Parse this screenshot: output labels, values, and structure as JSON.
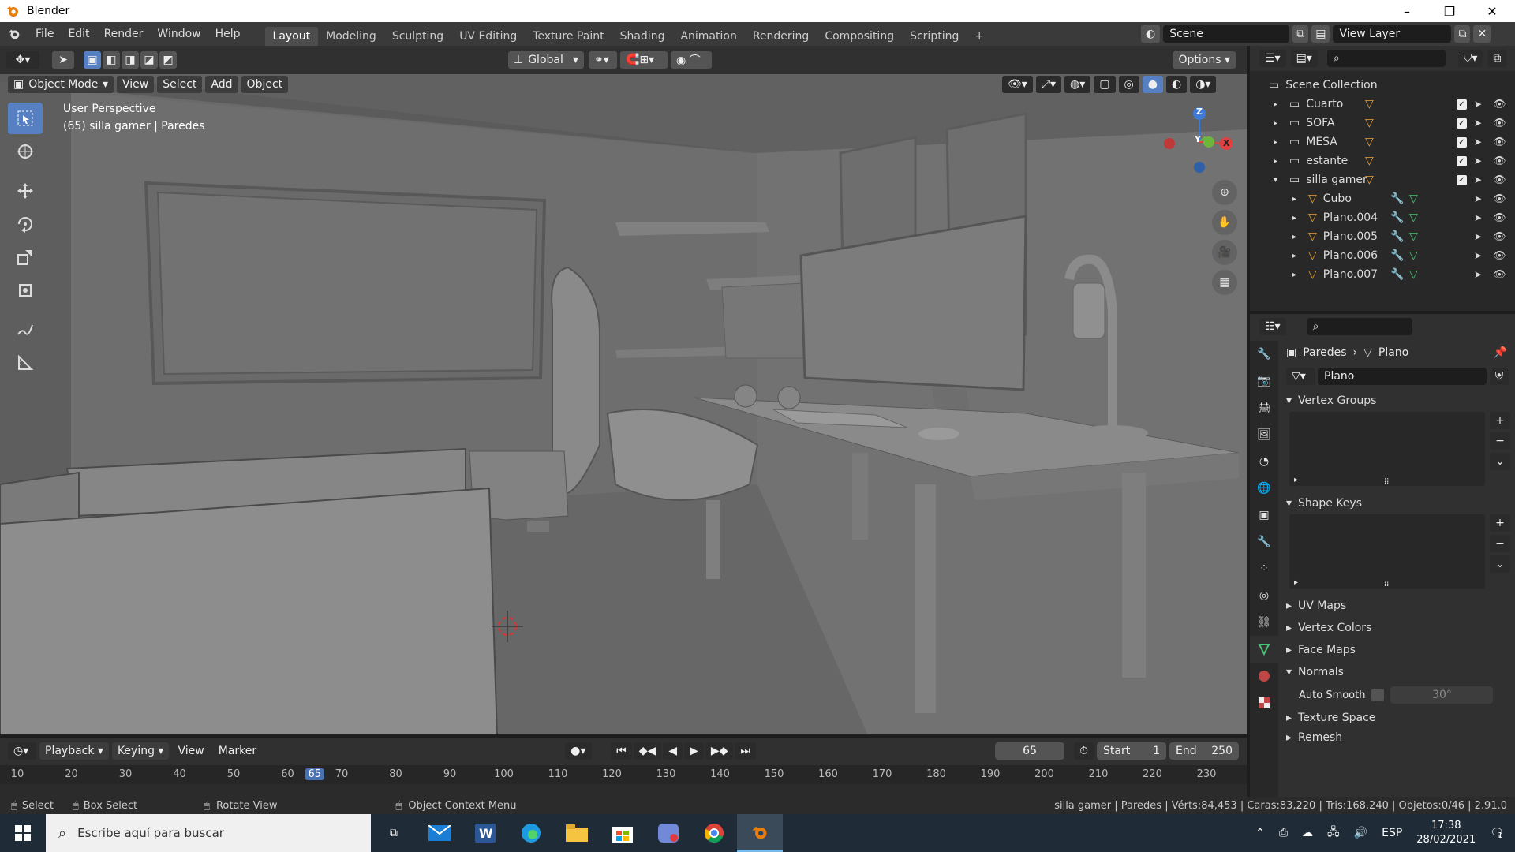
{
  "window": {
    "title": "Blender"
  },
  "menu": [
    "File",
    "Edit",
    "Render",
    "Window",
    "Help"
  ],
  "workspaces": [
    "Layout",
    "Modeling",
    "Sculpting",
    "UV Editing",
    "Texture Paint",
    "Shading",
    "Animation",
    "Rendering",
    "Compositing",
    "Scripting"
  ],
  "active_workspace": "Layout",
  "scene": {
    "name": "Scene",
    "view_layer": "View Layer"
  },
  "viewport": {
    "transform": "Global",
    "options_label": "Options",
    "mode": "Object Mode",
    "menus": [
      "View",
      "Select",
      "Add",
      "Object"
    ],
    "overlay_title": "User Perspective",
    "overlay_sub": "(65) silla gamer | Paredes",
    "gizmo": {
      "z": "Z",
      "y": "Y",
      "x": "X"
    }
  },
  "outliner": {
    "root": "Scene Collection",
    "items": [
      {
        "name": "Cuarto",
        "level": 1,
        "expanded": false
      },
      {
        "name": "SOFA",
        "level": 1,
        "expanded": false
      },
      {
        "name": "MESA",
        "level": 1,
        "expanded": false
      },
      {
        "name": "estante",
        "level": 1,
        "expanded": false
      },
      {
        "name": "silla gamer",
        "level": 1,
        "expanded": true
      },
      {
        "name": "Cubo",
        "level": 2
      },
      {
        "name": "Plano.004",
        "level": 2
      },
      {
        "name": "Plano.005",
        "level": 2
      },
      {
        "name": "Plano.006",
        "level": 2
      },
      {
        "name": "Plano.007",
        "level": 2
      }
    ]
  },
  "properties": {
    "breadcrumb_object": "Paredes",
    "breadcrumb_data": "Plano",
    "data_name": "Plano",
    "panels": {
      "vertex_groups": "Vertex Groups",
      "shape_keys": "Shape Keys",
      "uv_maps": "UV Maps",
      "vertex_colors": "Vertex Colors",
      "face_maps": "Face Maps",
      "normals": "Normals",
      "auto_smooth": "Auto Smooth",
      "auto_smooth_angle": "30°",
      "texture_space": "Texture Space",
      "remesh": "Remesh"
    }
  },
  "timeline": {
    "menus": [
      "Playback",
      "Keying",
      "View",
      "Marker"
    ],
    "current_frame": "65",
    "start_label": "Start",
    "start": "1",
    "end_label": "End",
    "end": "250",
    "ticks": [
      "10",
      "20",
      "30",
      "40",
      "50",
      "60",
      "65",
      "70",
      "80",
      "90",
      "100",
      "110",
      "120",
      "130",
      "140",
      "150",
      "160",
      "170",
      "180",
      "190",
      "200",
      "210",
      "220",
      "230"
    ],
    "current_tick": "65"
  },
  "status": {
    "select": "Select",
    "box_select": "Box Select",
    "rotate_view": "Rotate View",
    "context_menu": "Object Context Menu",
    "stats": "silla gamer | Paredes | Vérts:84,453 | Caras:83,220 | Tris:168,240 | Objetos:0/46 | 2.91.0"
  },
  "taskbar": {
    "search_placeholder": "Escribe aquí para buscar",
    "lang": "ESP",
    "time": "17:38",
    "date": "28/02/2021",
    "notif_count": "1"
  },
  "colors": {
    "accent": "#5680c2",
    "active_frame": "#4772b3",
    "orange": "#e87d0d"
  }
}
